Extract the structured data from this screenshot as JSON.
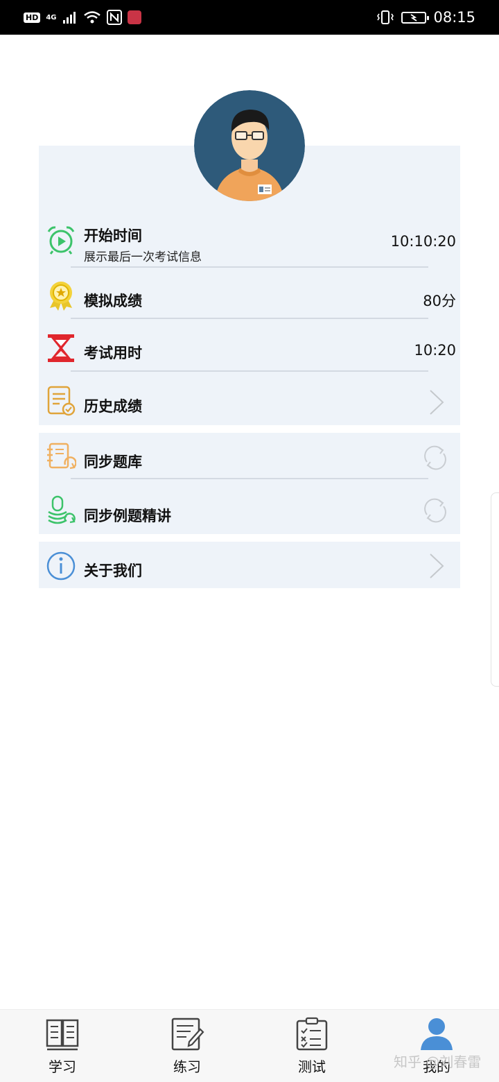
{
  "status_bar": {
    "network": "4G",
    "hd": "HD",
    "time": "08:15"
  },
  "profile": {
    "avatar_icon": "user-avatar-icon"
  },
  "menu": {
    "start_time": {
      "title": "开始时间",
      "subtitle": "展示最后一次考试信息",
      "value": "10:10:20",
      "icon": "alarm-clock-play-icon"
    },
    "mock_score": {
      "title": "模拟成绩",
      "value": "80分",
      "icon": "medal-icon"
    },
    "exam_duration": {
      "title": "考试用时",
      "value": "10:20",
      "icon": "hourglass-icon"
    },
    "history_score": {
      "title": "历史成绩",
      "icon": "document-check-icon"
    },
    "sync_bank": {
      "title": "同步题库",
      "icon": "question-bank-sync-icon"
    },
    "sync_examples": {
      "title": "同步例题精讲",
      "icon": "microphone-sync-icon"
    },
    "about_us": {
      "title": "关于我们",
      "icon": "info-icon"
    }
  },
  "bottom_nav": {
    "tabs": [
      {
        "label": "学习",
        "icon": "book-icon",
        "active": false
      },
      {
        "label": "练习",
        "icon": "notepad-pencil-icon",
        "active": false
      },
      {
        "label": "测试",
        "icon": "clipboard-checklist-icon",
        "active": false
      },
      {
        "label": "我的",
        "icon": "person-icon",
        "active": true
      }
    ]
  },
  "watermark": "知乎 @刘春雷",
  "colors": {
    "card_bg": "#eef3f9",
    "accent_blue": "#4a8fd6",
    "green": "#3cc36a",
    "red": "#e0262d",
    "orange": "#e8a23a"
  }
}
